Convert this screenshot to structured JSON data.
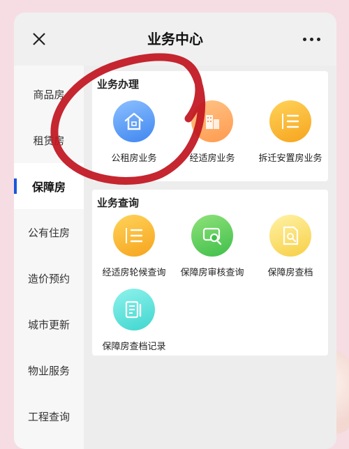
{
  "header": {
    "title": "业务中心",
    "close_icon": "close-icon",
    "more_icon": "more-horizontal-icon"
  },
  "sidebar": {
    "items": [
      {
        "label": "商品房"
      },
      {
        "label": "租赁房"
      },
      {
        "label": "保障房",
        "active": true
      },
      {
        "label": "公有住房"
      },
      {
        "label": "造价预约"
      },
      {
        "label": "城市更新"
      },
      {
        "label": "物业服务"
      },
      {
        "label": "工程查询"
      }
    ]
  },
  "sections": [
    {
      "title": "业务办理",
      "tiles": [
        {
          "label": "公租房业务",
          "icon": "house-icon",
          "color": "#5aa0f5"
        },
        {
          "label": "经适房业务",
          "icon": "building-icon",
          "color": "#ffae6a"
        },
        {
          "label": "拆迁安置房业务",
          "icon": "numbered-list-icon",
          "color": "#f8b52a"
        }
      ]
    },
    {
      "title": "业务查询",
      "tiles": [
        {
          "label": "经适房轮候查询",
          "icon": "numbered-list-icon",
          "color": "#f8b52a"
        },
        {
          "label": "保障房审核查询",
          "icon": "search-card-icon",
          "color": "#4ccb52"
        },
        {
          "label": "保障房查档",
          "icon": "document-search-icon",
          "color": "#f8d553"
        },
        {
          "label": "保障房查档记录",
          "icon": "document-edit-icon",
          "color": "#55ddd6"
        }
      ]
    }
  ],
  "colors": {
    "accent": "#1a56db",
    "annotation": "#c0141e"
  }
}
